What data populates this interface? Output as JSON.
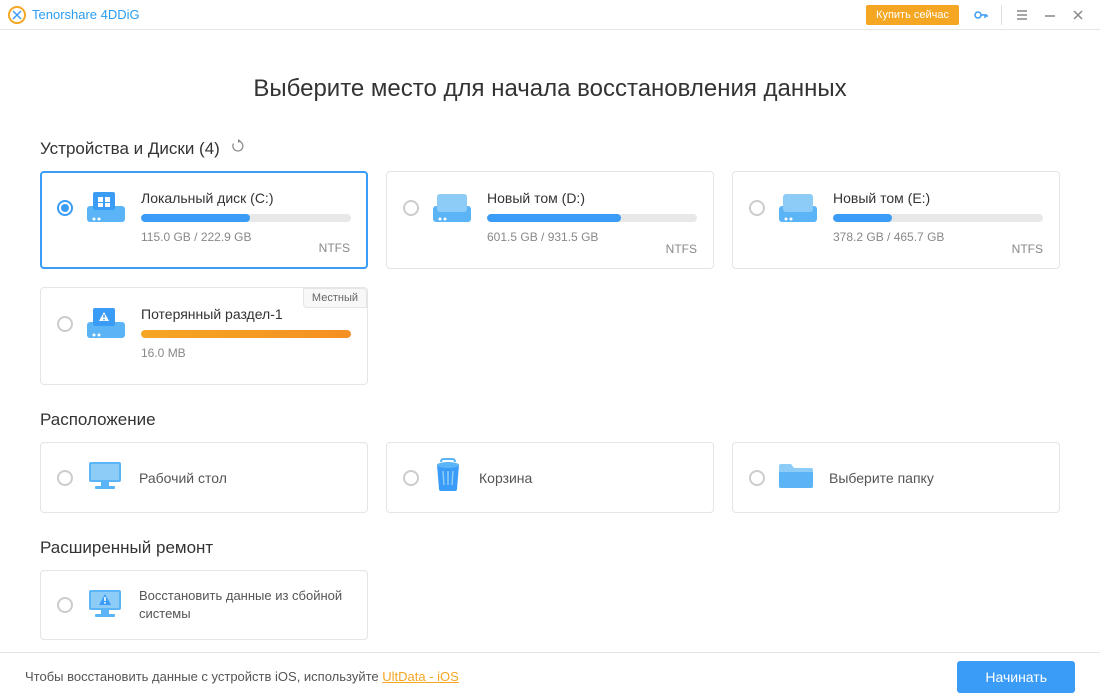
{
  "titlebar": {
    "app_name": "Tenorshare 4DDiG",
    "buy_label": "Купить сейчас"
  },
  "main": {
    "title": "Выберите место для начала восстановления данных"
  },
  "devices": {
    "title": "Устройства и Диски (4)",
    "drives": [
      {
        "name": "Локальный диск (C:)",
        "size": "115.0 GB / 222.9 GB",
        "fs": "NTFS",
        "pct": 52,
        "selected": true,
        "color": "blue",
        "icon": "windows"
      },
      {
        "name": "Новый том (D:)",
        "size": "601.5 GB / 931.5 GB",
        "fs": "NTFS",
        "pct": 64,
        "selected": false,
        "color": "blue",
        "icon": "drive"
      },
      {
        "name": "Новый том (E:)",
        "size": "378.2 GB / 465.7 GB",
        "fs": "NTFS",
        "pct": 28,
        "selected": false,
        "color": "blue",
        "icon": "drive"
      },
      {
        "name": "Потерянный раздел-1",
        "size": "16.0 MB",
        "fs": "",
        "pct": 100,
        "selected": false,
        "color": "orange",
        "icon": "warning",
        "badge": "Местный"
      }
    ]
  },
  "location": {
    "title": "Расположение",
    "items": [
      {
        "label": "Рабочий стол",
        "icon": "desktop"
      },
      {
        "label": "Корзина",
        "icon": "trash"
      },
      {
        "label": "Выберите папку",
        "icon": "folder"
      }
    ]
  },
  "repair": {
    "title": "Расширенный ремонт",
    "item_label": "Восстановить данные из сбойной системы"
  },
  "footer": {
    "text": "Чтобы восстановить данные с устройств iOS, используйте ",
    "link": "UltData - iOS",
    "start_label": "Начинать"
  }
}
